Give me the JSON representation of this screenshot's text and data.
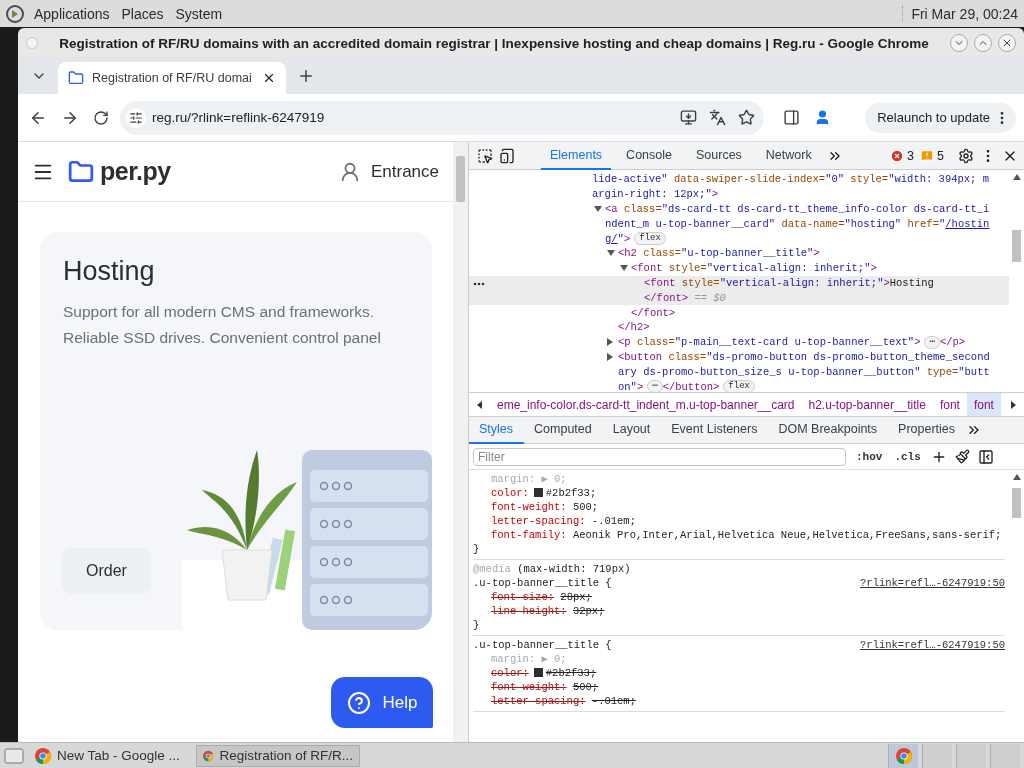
{
  "top_panel": {
    "menus": [
      "Applications",
      "Places",
      "System"
    ],
    "clock": "Fri Mar 29, 00:24"
  },
  "window": {
    "title": "Registration of RF/RU domains with an accredited domain registrar | Inexpensive hosting and cheap domains | Reg.ru - Google Chrome"
  },
  "tabs": [
    {
      "label": "Registration of RF/RU domai",
      "selected": true
    }
  ],
  "toolbar": {
    "url": "reg.ru/?rlink=reflink-6247919",
    "relaunch": "Relaunch to update"
  },
  "page": {
    "logo": "per.py",
    "login": "Entrance",
    "card": {
      "title": "Hosting",
      "text": "Support for all modern CMS and frameworks. Reliable SSD drives. Convenient control panel",
      "button": "Order"
    },
    "help": "Help"
  },
  "devtools": {
    "tabs": [
      {
        "label": "Elements",
        "selected": true
      },
      {
        "label": "Console",
        "selected": false
      },
      {
        "label": "Sources",
        "selected": false
      },
      {
        "label": "Network",
        "selected": false
      }
    ],
    "errors": "3",
    "warnings": "5",
    "tree": [
      {
        "selected": false,
        "lines": [
          [
            {
              "kind": "val",
              "text": "lide-active\""
            },
            {
              "kind": "attr",
              "text": " data-swiper-slide-index="
            },
            {
              "kind": "val",
              "text": "\"0\""
            },
            {
              "kind": "attr",
              "text": " style="
            },
            {
              "kind": "val",
              "text": "\"width: 394px; m"
            }
          ],
          [
            {
              "kind": "val",
              "text": "argin-right: 12px;\""
            },
            {
              "kind": "tag",
              "text": ">"
            }
          ]
        ],
        "children": [
          {
            "selected": false,
            "expanded": true,
            "lines": [
              [
                {
                  "kind": "tag",
                  "text": "<a"
                },
                {
                  "kind": "attr",
                  "text": " class="
                },
                {
                  "kind": "val",
                  "text": "\"ds-card-tt ds-card-tt_theme_info-color ds-card-tt_i"
                }
              ],
              [
                {
                  "kind": "val",
                  "text": "ndent_m u-top-banner__card\""
                },
                {
                  "kind": "attr",
                  "text": " data-name="
                },
                {
                  "kind": "val",
                  "text": "\"hosting\""
                },
                {
                  "kind": "attr",
                  "text": " href="
                },
                {
                  "kind": "val",
                  "text": "\""
                },
                {
                  "kind": "link",
                  "text": "/hostin"
                }
              ],
              [
                {
                  "kind": "link",
                  "text": "g/"
                },
                {
                  "kind": "val",
                  "text": "\""
                },
                {
                  "kind": "tag",
                  "text": ">"
                },
                {
                  "kind": "badge",
                  "text": "flex"
                }
              ]
            ],
            "children": [
              {
                "selected": false,
                "expanded": true,
                "lines": [
                  [
                    {
                      "kind": "tag",
                      "text": "<h2"
                    },
                    {
                      "kind": "attr",
                      "text": " class="
                    },
                    {
                      "kind": "val",
                      "text": "\"u-top-banner__title\""
                    },
                    {
                      "kind": "tag",
                      "text": ">"
                    }
                  ]
                ],
                "children": [
                  {
                    "selected": false,
                    "expanded": true,
                    "lines": [
                      [
                        {
                          "kind": "tag",
                          "text": "<font"
                        },
                        {
                          "kind": "attr",
                          "text": " style="
                        },
                        {
                          "kind": "val",
                          "text": "\"vertical-align: inherit;\""
                        },
                        {
                          "kind": "tag",
                          "text": ">"
                        }
                      ]
                    ],
                    "children": [
                      {
                        "selected": true,
                        "lines": [
                          [
                            {
                              "kind": "tag",
                              "text": "<font"
                            },
                            {
                              "kind": "attr",
                              "text": " style="
                            },
                            {
                              "kind": "val",
                              "text": "\"vertical-align: inherit;\""
                            },
                            {
                              "kind": "tag",
                              "text": ">"
                            },
                            {
                              "kind": "text",
                              "text": "Hosting"
                            }
                          ],
                          [
                            {
                              "kind": "tag",
                              "text": "</font>"
                            },
                            {
                              "kind": "dim",
                              "text": " == $0"
                            }
                          ]
                        ]
                      }
                    ],
                    "closing": [
                      {
                        "kind": "tag",
                        "text": "</font>"
                      }
                    ]
                  }
                ],
                "closing": [
                  {
                    "kind": "tag",
                    "text": "</h2>"
                  }
                ]
              },
              {
                "selected": false,
                "expanded": false,
                "lines": [
                  [
                    {
                      "kind": "tag",
                      "text": "<p"
                    },
                    {
                      "kind": "attr",
                      "text": " class="
                    },
                    {
                      "kind": "val",
                      "text": "\"p-main__text-card u-top-banner__text\""
                    },
                    {
                      "kind": "tag",
                      "text": ">"
                    },
                    {
                      "kind": "ellipsis",
                      "text": "⋯"
                    },
                    {
                      "kind": "tag",
                      "text": "</p>"
                    }
                  ]
                ]
              },
              {
                "selected": false,
                "expanded": false,
                "lines": [
                  [
                    {
                      "kind": "tag",
                      "text": "<button"
                    },
                    {
                      "kind": "attr",
                      "text": " class="
                    },
                    {
                      "kind": "val",
                      "text": "\"ds-promo-button ds-promo-button_theme_second"
                    }
                  ],
                  [
                    {
                      "kind": "val",
                      "text": "ary ds-promo-button_size_s u-top-banner__button\""
                    },
                    {
                      "kind": "attr",
                      "text": " type="
                    },
                    {
                      "kind": "val",
                      "text": "\"butt"
                    }
                  ],
                  [
                    {
                      "kind": "val",
                      "text": "on\""
                    },
                    {
                      "kind": "tag",
                      "text": ">"
                    },
                    {
                      "kind": "ellipsis",
                      "text": "⋯"
                    },
                    {
                      "kind": "tag",
                      "text": "</button>"
                    },
                    {
                      "kind": "badge",
                      "text": "flex"
                    }
                  ]
                ]
              }
            ]
          }
        ]
      }
    ],
    "breadcrumbs": [
      {
        "label": "eme_info-color.ds-card-tt_indent_m.u-top-banner__card",
        "selected": false
      },
      {
        "label": "h2.u-top-banner__title",
        "selected": false
      },
      {
        "label": "font",
        "selected": false
      },
      {
        "label": "font",
        "selected": true
      }
    ],
    "style_tabs": [
      {
        "label": "Styles",
        "selected": true
      },
      {
        "label": "Computed",
        "selected": false
      },
      {
        "label": "Layout",
        "selected": false
      },
      {
        "label": "Event Listeners",
        "selected": false
      },
      {
        "label": "DOM Breakpoints",
        "selected": false
      },
      {
        "label": "Properties",
        "selected": false
      }
    ],
    "filter": {
      "placeholder": "Filter"
    },
    "filter_buttons": [
      ":hov",
      ".cls"
    ],
    "rules": [
      {
        "props": [
          {
            "kind": "inactive",
            "name": "margin:",
            "value": "▶ 0;"
          },
          {
            "kind": "active",
            "name": "color:",
            "swatch": true,
            "value": "#2b2f33;"
          },
          {
            "kind": "active",
            "name": "font-weight:",
            "value": "500;"
          },
          {
            "kind": "active",
            "name": "letter-spacing:",
            "value": "-.01em;"
          },
          {
            "kind": "active",
            "name": "font-family:",
            "value": "Aeonik Pro,Inter,Arial,Helvetica Neue,Helvetica,FreeSans,sans-serif;"
          }
        ],
        "close": "}"
      },
      {
        "media": {
          "keyword": "@media",
          "query": "(max-width: 719px)"
        },
        "selector": ".u-top-banner__title {",
        "source": "?rlink=refl…-6247919:50",
        "props": [
          {
            "kind": "overridden",
            "name": "font-size:",
            "value": "28px;"
          },
          {
            "kind": "overridden",
            "name": "line-height:",
            "value": "32px;"
          }
        ],
        "close": "}"
      },
      {
        "selector": ".u-top-banner__title {",
        "source": "?rlink=refl…-6247919:50",
        "props": [
          {
            "kind": "inactive",
            "name": "margin:",
            "value": "▶ 0;"
          },
          {
            "kind": "overridden",
            "name": "color:",
            "swatch": true,
            "value": "#2b2f33;"
          },
          {
            "kind": "overridden",
            "name": "font-weight:",
            "value": "500;"
          },
          {
            "kind": "overridden",
            "name": "letter-spacing:",
            "value": "-.01em;"
          }
        ]
      }
    ]
  },
  "taskbar": {
    "tasks": [
      {
        "label": "New Tab - Google ...",
        "selected": false
      },
      {
        "label": "Registration of RF/R...",
        "selected": true
      }
    ]
  }
}
